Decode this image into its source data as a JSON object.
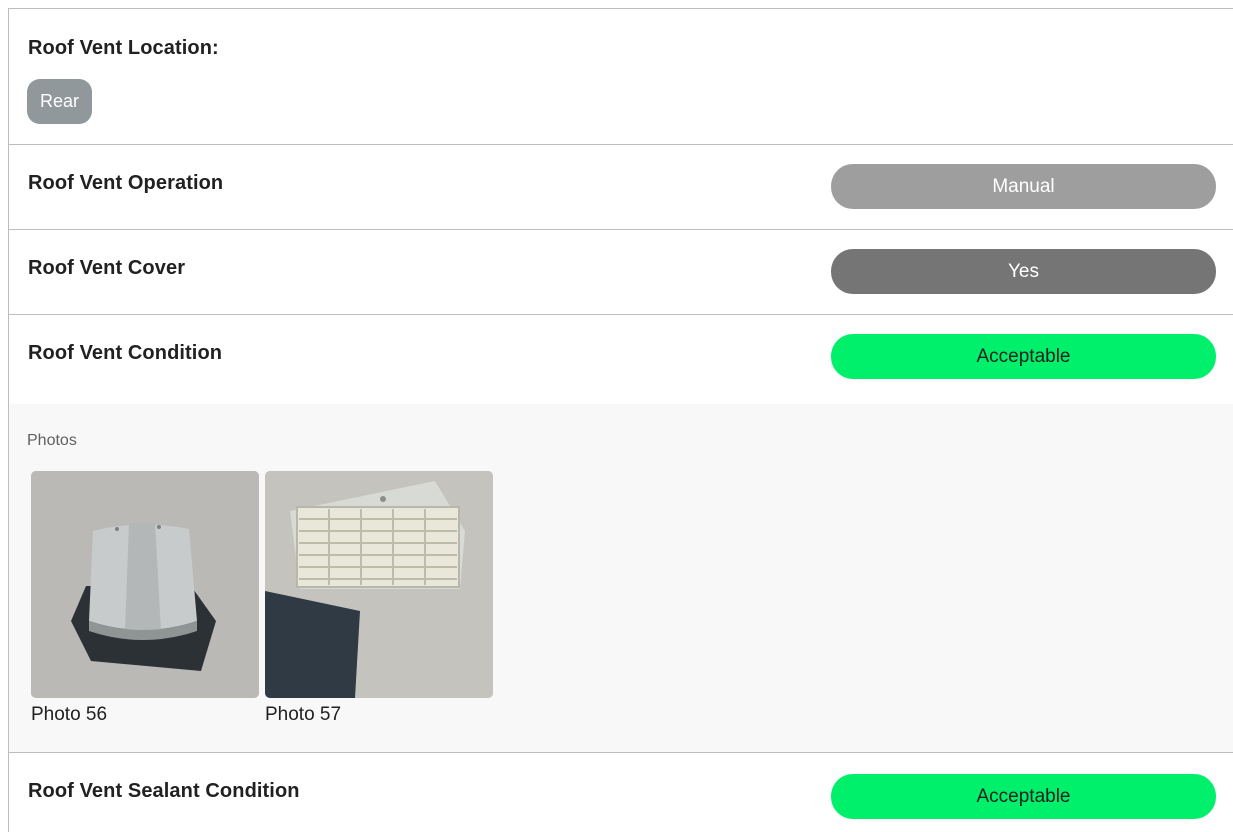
{
  "rows": {
    "location": {
      "label": "Roof Vent Location:",
      "value": "Rear"
    },
    "operation": {
      "label": "Roof Vent Operation",
      "value": "Manual"
    },
    "cover": {
      "label": "Roof Vent Cover",
      "value": "Yes"
    },
    "condition": {
      "label": "Roof Vent Condition",
      "value": "Acceptable"
    },
    "sealant": {
      "label": "Roof Vent Sealant Condition",
      "value": "Acceptable"
    }
  },
  "photos": {
    "heading": "Photos",
    "items": [
      {
        "caption": "Photo 56",
        "subject": "roof-vent-cover-photo"
      },
      {
        "caption": "Photo 57",
        "subject": "roof-vent-louver-photo"
      }
    ]
  },
  "colors": {
    "acceptable": "#00f06b",
    "manual": "#9e9e9e",
    "yes": "#757575",
    "chip": "#90989c",
    "divider": "#bdbdbd"
  }
}
